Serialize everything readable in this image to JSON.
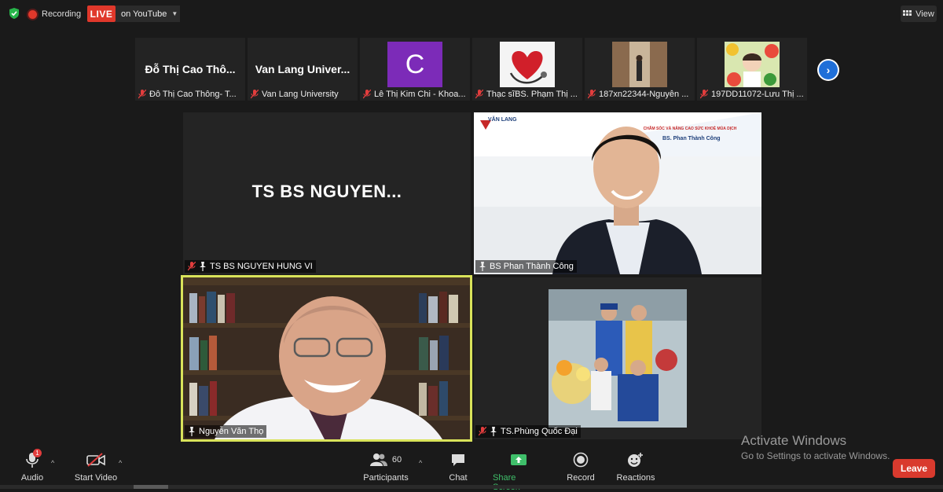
{
  "topbar": {
    "recording_label": "Recording",
    "live_label": "LIVE",
    "stream_target": "on YouTube",
    "view_label": "View"
  },
  "thumbnails": [
    {
      "display": "Đỗ Thị Cao Thô...",
      "label": "Đỗ Thị Cao Thông- T...",
      "kind": "name"
    },
    {
      "display": "Van Lang Univer...",
      "label": "Van Lang University",
      "kind": "name"
    },
    {
      "display": "C",
      "label": "Lê Thị Kim Chi - Khoa...",
      "kind": "avatar",
      "avatar_color": "#7c2bb8"
    },
    {
      "display": "",
      "label": "Thạc sĩBS. Phạm Thị ...",
      "kind": "image"
    },
    {
      "display": "",
      "label": "187xn22344-Nguyễn ...",
      "kind": "image"
    },
    {
      "display": "",
      "label": "197DD11072-Lưu Thị ...",
      "kind": "image"
    }
  ],
  "tiles": [
    {
      "display": "TS BS NGUYEN...",
      "label": "TS BS NGUYEN HUNG VI"
    },
    {
      "label": "BS Phan Thành Công",
      "banner_school": "VĂN LANG",
      "banner_title": "CHĂM SÓC VÀ NÂNG CAO SỨC KHOẺ MÙA DỊCH",
      "banner_name": "BS. Phan Thành Công"
    },
    {
      "label": "Nguyễn Văn Thọ"
    },
    {
      "label": "TS.Phùng Quốc Đại"
    }
  ],
  "watermark": {
    "title": "Activate Windows",
    "subtitle": "Go to Settings to activate Windows."
  },
  "toolbar": {
    "audio": "Audio",
    "audio_badge": "1",
    "video": "Start Video",
    "participants": "Participants",
    "participants_count": "60",
    "chat": "Chat",
    "share": "Share Screen",
    "record": "Record",
    "reactions": "Reactions",
    "leave": "Leave"
  },
  "colors": {
    "live_red": "#e0382b",
    "active_border": "#d9e35a",
    "share_green": "#3fbf6a",
    "leave_red": "#d93a2e"
  }
}
